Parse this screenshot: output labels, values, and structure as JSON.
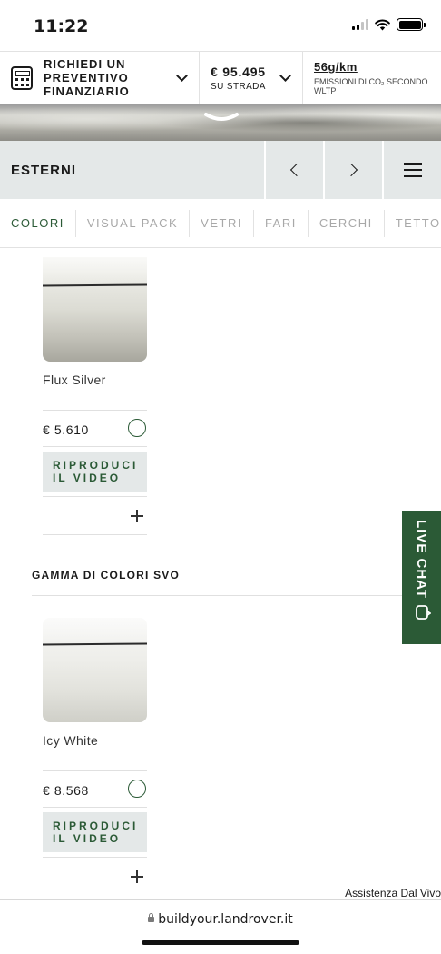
{
  "status_bar": {
    "time": "11:22"
  },
  "finance_bar": {
    "quote_label": "RICHIEDI UN PREVENTIVO FINANZIARIO",
    "price": "€ 95.495",
    "price_sub": "SU STRADA",
    "emissions": "56g/km",
    "emissions_sub_line1": "EMISSIONI DI CO₂ SECONDO",
    "emissions_sub_line2": "WLTP"
  },
  "section_nav": {
    "title": "ESTERNI"
  },
  "tabs": [
    {
      "label": "COLORI"
    },
    {
      "label": "VISUAL PACK"
    },
    {
      "label": "VETRI"
    },
    {
      "label": "FARI"
    },
    {
      "label": "CERCHI"
    },
    {
      "label": "TETTO"
    }
  ],
  "colors": [
    {
      "name": "Flux Silver",
      "price": "€ 5.610",
      "video_label": "RIPRODUCI IL VIDEO"
    },
    {
      "name": "Icy White",
      "price": "€ 8.568",
      "video_label": "RIPRODUCI IL VIDEO"
    }
  ],
  "group_title": "GAMMA DI COLORI SVO",
  "live_chat": {
    "label": "LIVE CHAT"
  },
  "assistance": "Assistenza Dal Vivo",
  "browser": {
    "url": "buildyour.landrover.it"
  },
  "theme": {
    "accent": "#2b5a36",
    "nav_bg": "#e4e8e8"
  }
}
